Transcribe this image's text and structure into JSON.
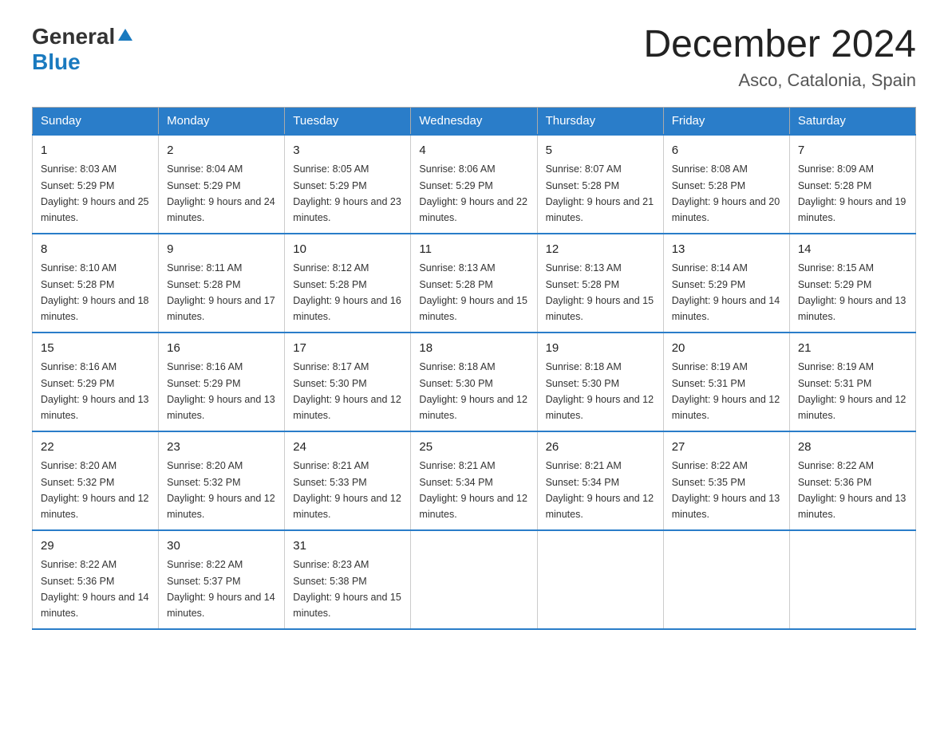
{
  "header": {
    "logo_general": "General",
    "logo_blue": "Blue",
    "title": "December 2024",
    "subtitle": "Asco, Catalonia, Spain"
  },
  "calendar": {
    "days": [
      "Sunday",
      "Monday",
      "Tuesday",
      "Wednesday",
      "Thursday",
      "Friday",
      "Saturday"
    ],
    "weeks": [
      [
        {
          "day": "1",
          "sunrise": "Sunrise: 8:03 AM",
          "sunset": "Sunset: 5:29 PM",
          "daylight": "Daylight: 9 hours and 25 minutes."
        },
        {
          "day": "2",
          "sunrise": "Sunrise: 8:04 AM",
          "sunset": "Sunset: 5:29 PM",
          "daylight": "Daylight: 9 hours and 24 minutes."
        },
        {
          "day": "3",
          "sunrise": "Sunrise: 8:05 AM",
          "sunset": "Sunset: 5:29 PM",
          "daylight": "Daylight: 9 hours and 23 minutes."
        },
        {
          "day": "4",
          "sunrise": "Sunrise: 8:06 AM",
          "sunset": "Sunset: 5:29 PM",
          "daylight": "Daylight: 9 hours and 22 minutes."
        },
        {
          "day": "5",
          "sunrise": "Sunrise: 8:07 AM",
          "sunset": "Sunset: 5:28 PM",
          "daylight": "Daylight: 9 hours and 21 minutes."
        },
        {
          "day": "6",
          "sunrise": "Sunrise: 8:08 AM",
          "sunset": "Sunset: 5:28 PM",
          "daylight": "Daylight: 9 hours and 20 minutes."
        },
        {
          "day": "7",
          "sunrise": "Sunrise: 8:09 AM",
          "sunset": "Sunset: 5:28 PM",
          "daylight": "Daylight: 9 hours and 19 minutes."
        }
      ],
      [
        {
          "day": "8",
          "sunrise": "Sunrise: 8:10 AM",
          "sunset": "Sunset: 5:28 PM",
          "daylight": "Daylight: 9 hours and 18 minutes."
        },
        {
          "day": "9",
          "sunrise": "Sunrise: 8:11 AM",
          "sunset": "Sunset: 5:28 PM",
          "daylight": "Daylight: 9 hours and 17 minutes."
        },
        {
          "day": "10",
          "sunrise": "Sunrise: 8:12 AM",
          "sunset": "Sunset: 5:28 PM",
          "daylight": "Daylight: 9 hours and 16 minutes."
        },
        {
          "day": "11",
          "sunrise": "Sunrise: 8:13 AM",
          "sunset": "Sunset: 5:28 PM",
          "daylight": "Daylight: 9 hours and 15 minutes."
        },
        {
          "day": "12",
          "sunrise": "Sunrise: 8:13 AM",
          "sunset": "Sunset: 5:28 PM",
          "daylight": "Daylight: 9 hours and 15 minutes."
        },
        {
          "day": "13",
          "sunrise": "Sunrise: 8:14 AM",
          "sunset": "Sunset: 5:29 PM",
          "daylight": "Daylight: 9 hours and 14 minutes."
        },
        {
          "day": "14",
          "sunrise": "Sunrise: 8:15 AM",
          "sunset": "Sunset: 5:29 PM",
          "daylight": "Daylight: 9 hours and 13 minutes."
        }
      ],
      [
        {
          "day": "15",
          "sunrise": "Sunrise: 8:16 AM",
          "sunset": "Sunset: 5:29 PM",
          "daylight": "Daylight: 9 hours and 13 minutes."
        },
        {
          "day": "16",
          "sunrise": "Sunrise: 8:16 AM",
          "sunset": "Sunset: 5:29 PM",
          "daylight": "Daylight: 9 hours and 13 minutes."
        },
        {
          "day": "17",
          "sunrise": "Sunrise: 8:17 AM",
          "sunset": "Sunset: 5:30 PM",
          "daylight": "Daylight: 9 hours and 12 minutes."
        },
        {
          "day": "18",
          "sunrise": "Sunrise: 8:18 AM",
          "sunset": "Sunset: 5:30 PM",
          "daylight": "Daylight: 9 hours and 12 minutes."
        },
        {
          "day": "19",
          "sunrise": "Sunrise: 8:18 AM",
          "sunset": "Sunset: 5:30 PM",
          "daylight": "Daylight: 9 hours and 12 minutes."
        },
        {
          "day": "20",
          "sunrise": "Sunrise: 8:19 AM",
          "sunset": "Sunset: 5:31 PM",
          "daylight": "Daylight: 9 hours and 12 minutes."
        },
        {
          "day": "21",
          "sunrise": "Sunrise: 8:19 AM",
          "sunset": "Sunset: 5:31 PM",
          "daylight": "Daylight: 9 hours and 12 minutes."
        }
      ],
      [
        {
          "day": "22",
          "sunrise": "Sunrise: 8:20 AM",
          "sunset": "Sunset: 5:32 PM",
          "daylight": "Daylight: 9 hours and 12 minutes."
        },
        {
          "day": "23",
          "sunrise": "Sunrise: 8:20 AM",
          "sunset": "Sunset: 5:32 PM",
          "daylight": "Daylight: 9 hours and 12 minutes."
        },
        {
          "day": "24",
          "sunrise": "Sunrise: 8:21 AM",
          "sunset": "Sunset: 5:33 PM",
          "daylight": "Daylight: 9 hours and 12 minutes."
        },
        {
          "day": "25",
          "sunrise": "Sunrise: 8:21 AM",
          "sunset": "Sunset: 5:34 PM",
          "daylight": "Daylight: 9 hours and 12 minutes."
        },
        {
          "day": "26",
          "sunrise": "Sunrise: 8:21 AM",
          "sunset": "Sunset: 5:34 PM",
          "daylight": "Daylight: 9 hours and 12 minutes."
        },
        {
          "day": "27",
          "sunrise": "Sunrise: 8:22 AM",
          "sunset": "Sunset: 5:35 PM",
          "daylight": "Daylight: 9 hours and 13 minutes."
        },
        {
          "day": "28",
          "sunrise": "Sunrise: 8:22 AM",
          "sunset": "Sunset: 5:36 PM",
          "daylight": "Daylight: 9 hours and 13 minutes."
        }
      ],
      [
        {
          "day": "29",
          "sunrise": "Sunrise: 8:22 AM",
          "sunset": "Sunset: 5:36 PM",
          "daylight": "Daylight: 9 hours and 14 minutes."
        },
        {
          "day": "30",
          "sunrise": "Sunrise: 8:22 AM",
          "sunset": "Sunset: 5:37 PM",
          "daylight": "Daylight: 9 hours and 14 minutes."
        },
        {
          "day": "31",
          "sunrise": "Sunrise: 8:23 AM",
          "sunset": "Sunset: 5:38 PM",
          "daylight": "Daylight: 9 hours and 15 minutes."
        },
        null,
        null,
        null,
        null
      ]
    ]
  }
}
